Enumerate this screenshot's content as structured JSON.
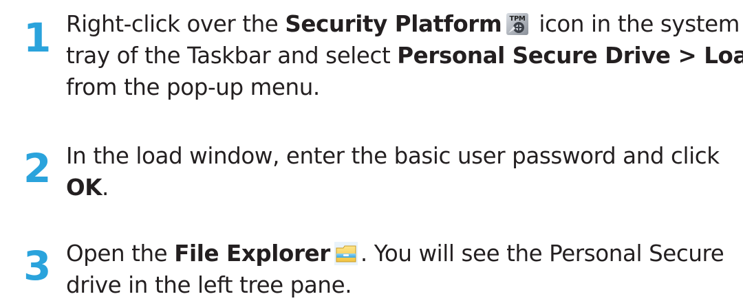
{
  "steps": [
    {
      "number": "1",
      "lines": [
        {
          "a": "Right-click over the ",
          "b": "Security Platform",
          "c": " icon in the system"
        },
        {
          "a": "tray of the Taskbar and select ",
          "b": "Personal Secure Drive > Load"
        },
        {
          "a": "from the pop-up menu."
        }
      ],
      "icon": "tpm-security-platform-icon"
    },
    {
      "number": "2",
      "lines": [
        {
          "a": "In the load window, enter the basic user password and click"
        },
        {
          "b": "OK",
          "c": "."
        }
      ]
    },
    {
      "number": "3",
      "lines": [
        {
          "a": "Open the ",
          "b": "File Explorer",
          "c": ". You will see the Personal Secure"
        },
        {
          "a": "drive in the left tree pane."
        }
      ],
      "icon": "file-explorer-folder-icon"
    }
  ],
  "colors": {
    "step_number": "#2aa3dc",
    "text": "#231f20"
  }
}
